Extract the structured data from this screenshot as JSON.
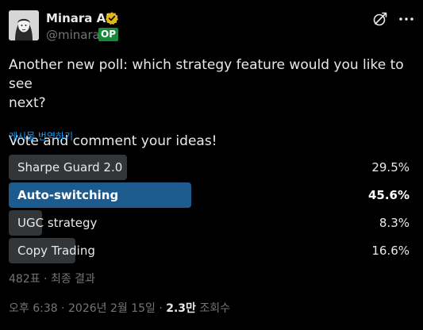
{
  "author": {
    "display_name": "Minara AI",
    "handle": "@minara",
    "op_badge": "OP",
    "verified_icon": "verified-gold-badge",
    "avatar_icon": "avatar-illustration"
  },
  "header_icons": {
    "grok": "grok-icon",
    "more": "more-icon"
  },
  "post": {
    "text": "Another new poll: which strategy feature would you like to see\nnext?\n\nVote and comment your ideas!",
    "translate_label": "게시물 번역하기"
  },
  "poll": {
    "options": [
      {
        "label": "Sharpe Guard 2.0",
        "percent_label": "29.5%",
        "percent": 29.5,
        "winner": false
      },
      {
        "label": "Auto-switching",
        "percent_label": "45.6%",
        "percent": 45.6,
        "winner": true
      },
      {
        "label": "UGC strategy",
        "percent_label": "8.3%",
        "percent": 8.3,
        "winner": false
      },
      {
        "label": "Copy Trading",
        "percent_label": "16.6%",
        "percent": 16.6,
        "winner": false
      }
    ],
    "summary": "482표 · 최종 결과"
  },
  "meta": {
    "time_date": "오후 6:38 · 2026년 2월 15일 · ",
    "views_count": "2.3만",
    "views_label": " 조회수"
  },
  "colors": {
    "background": "#000000",
    "text": "#e7e9ea",
    "muted": "#71767b",
    "link": "#1d9bf0",
    "poll_bar": "#333639",
    "poll_winner_bar": "#1d5b8f",
    "op_badge": "#1a8a3a",
    "verified": "#e2b719"
  }
}
